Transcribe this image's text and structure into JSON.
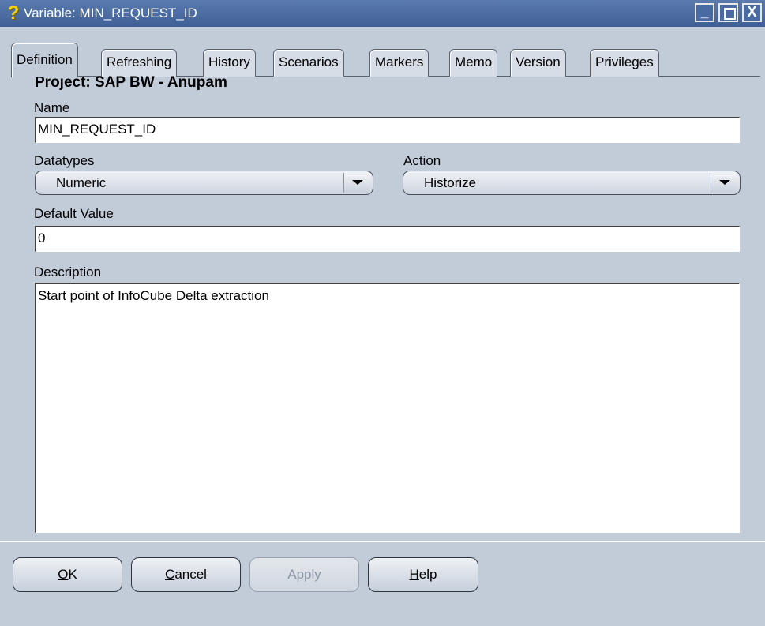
{
  "window": {
    "title": "Variable: MIN_REQUEST_ID",
    "icon": "question-mark-icon",
    "controls": [
      "_",
      "□",
      "X"
    ]
  },
  "tabs": [
    {
      "label": "Definition",
      "active": true
    },
    {
      "label": "Refreshing",
      "active": false
    },
    {
      "label": "History",
      "active": false
    },
    {
      "label": "Scenarios",
      "active": false
    },
    {
      "label": "Markers",
      "active": false
    },
    {
      "label": "Memo",
      "active": false
    },
    {
      "label": "Version",
      "active": false
    },
    {
      "label": "Privileges",
      "active": false
    }
  ],
  "form": {
    "project": "Project: SAP BW - Anupam",
    "name_label": "Name",
    "name_value": "MIN_REQUEST_ID",
    "datatypes_label": "Datatypes",
    "datatypes_value": "Numeric",
    "action_label": "Action",
    "action_value": "Historize",
    "default_label": "Default Value",
    "default_value": "0",
    "description_label": "Description",
    "description_value": "Start point of InfoCube Delta extraction"
  },
  "buttons": {
    "ok_first": "O",
    "ok_rest": "K",
    "cancel_first": "C",
    "cancel_rest": "ancel",
    "apply": "Apply",
    "help_first": "H",
    "help_rest": "elp"
  },
  "colors": {
    "titlebar": "#4a6aa2",
    "background": "#c2ccd9",
    "disabled_text": "#8e96a3"
  }
}
